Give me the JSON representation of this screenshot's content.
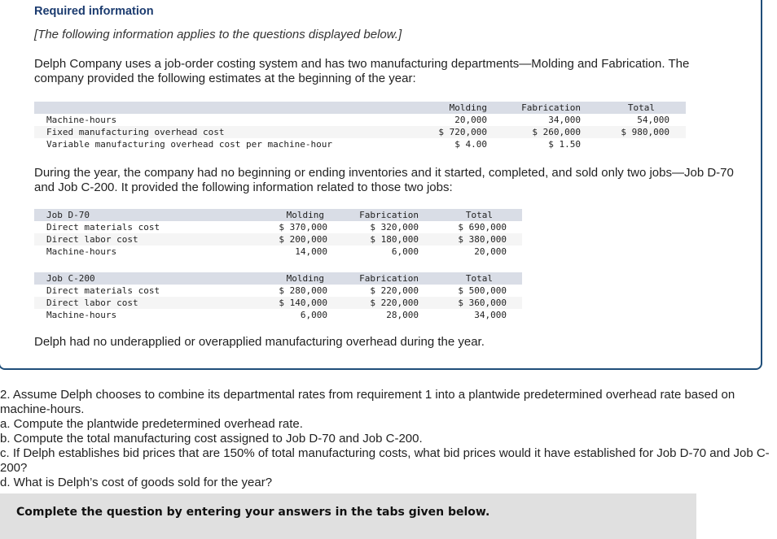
{
  "header": {
    "title": "Required information",
    "note": "[The following information applies to the questions displayed below.]"
  },
  "intro_paragraph": "Delph Company uses a job-order costing system and has two manufacturing departments—Molding and Fabrication. The company provided the following estimates at the beginning of the year:",
  "estimates_table": {
    "columns": [
      "",
      "Molding",
      "Fabrication",
      "Total"
    ],
    "rows": [
      {
        "label": "Machine-hours",
        "molding": "20,000",
        "fabrication": "34,000",
        "total": "54,000"
      },
      {
        "label": "Fixed manufacturing overhead cost",
        "molding": "$ 720,000",
        "fabrication": "$ 260,000",
        "total": "$ 980,000"
      },
      {
        "label": "Variable manufacturing overhead cost per machine-hour",
        "molding": "$ 4.00",
        "fabrication": "$ 1.50",
        "total": ""
      }
    ]
  },
  "jobs_paragraph": "During the year, the company had no beginning or ending inventories and it started, completed, and sold only two jobs—Job D-70 and Job C-200. It provided the following information related to those two jobs:",
  "job_d70": {
    "columns": [
      "Job D-70",
      "Molding",
      "Fabrication",
      "Total"
    ],
    "rows": [
      {
        "label": "Direct materials cost",
        "molding": "$ 370,000",
        "fabrication": "$ 320,000",
        "total": "$ 690,000"
      },
      {
        "label": "Direct labor cost",
        "molding": "$ 200,000",
        "fabrication": "$ 180,000",
        "total": "$ 380,000"
      },
      {
        "label": "Machine-hours",
        "molding": "14,000",
        "fabrication": "6,000",
        "total": "20,000"
      }
    ]
  },
  "job_c200": {
    "columns": [
      "Job C-200",
      "Molding",
      "Fabrication",
      "Total"
    ],
    "rows": [
      {
        "label": "Direct materials cost",
        "molding": "$ 280,000",
        "fabrication": "$ 220,000",
        "total": "$ 500,000"
      },
      {
        "label": "Direct labor cost",
        "molding": "$ 140,000",
        "fabrication": "$ 220,000",
        "total": "$ 360,000"
      },
      {
        "label": "Machine-hours",
        "molding": "6,000",
        "fabrication": "28,000",
        "total": "34,000"
      }
    ]
  },
  "closing_paragraph": "Delph had no underapplied or overapplied manufacturing overhead during the year.",
  "questions": {
    "q2": "2. Assume Delph chooses to combine its departmental rates from requirement 1 into a plantwide predetermined overhead rate based on machine-hours.",
    "a": "a. Compute the plantwide predetermined overhead rate.",
    "b": "b. Compute the total manufacturing cost assigned to Job D-70 and Job C-200.",
    "c": "c. If Delph establishes bid prices that are 150% of total manufacturing costs, what bid prices would it have established for Job D-70 and Job C-200?",
    "d": "d. What is Delph’s cost of goods sold for the year?"
  },
  "instruction": "Complete the question by entering your answers in the tabs given below.",
  "colors": {
    "title": "#1b3b6f",
    "box_border": "#1f4e79",
    "table_header_bg": "#d9dde6",
    "table_alt_bg": "#f5f5f5",
    "instruction_bg": "#e0e0e0"
  }
}
